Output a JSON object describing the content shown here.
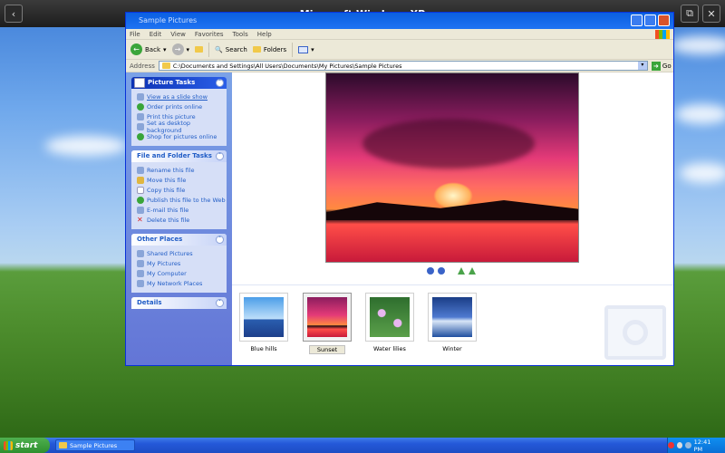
{
  "overlay_bar": {
    "title": "Microsoft Windows XP"
  },
  "window": {
    "title": "Sample Pictures",
    "menu": [
      "File",
      "Edit",
      "View",
      "Favorites",
      "Tools",
      "Help"
    ],
    "toolbar": {
      "back": "Back",
      "search": "Search",
      "folders": "Folders"
    },
    "address": {
      "label": "Address",
      "path": "C:\\Documents and Settings\\All Users\\Documents\\My Pictures\\Sample Pictures",
      "go": "Go"
    }
  },
  "sidebar": {
    "picture_tasks": {
      "title": "Picture Tasks",
      "items": [
        "View as a slide show",
        "Order prints online",
        "Print this picture",
        "Set as desktop background",
        "Shop for pictures online"
      ]
    },
    "file_tasks": {
      "title": "File and Folder Tasks",
      "items": [
        "Rename this file",
        "Move this file",
        "Copy this file",
        "Publish this file to the Web",
        "E-mail this file",
        "Delete this file"
      ]
    },
    "other_places": {
      "title": "Other Places",
      "items": [
        "Shared Pictures",
        "My Pictures",
        "My Computer",
        "My Network Places"
      ]
    },
    "details": {
      "title": "Details"
    }
  },
  "thumbnails": [
    {
      "label": "Blue hills",
      "color": "#3a76c8"
    },
    {
      "label": "Sunset",
      "color": "#e43a78",
      "selected": true
    },
    {
      "label": "Water lilies",
      "color": "#3c8a3c"
    },
    {
      "label": "Winter",
      "color": "#1f4fa0"
    }
  ],
  "taskbar": {
    "start": "start",
    "task": "Sample Pictures",
    "clock": "12:41 PM"
  }
}
